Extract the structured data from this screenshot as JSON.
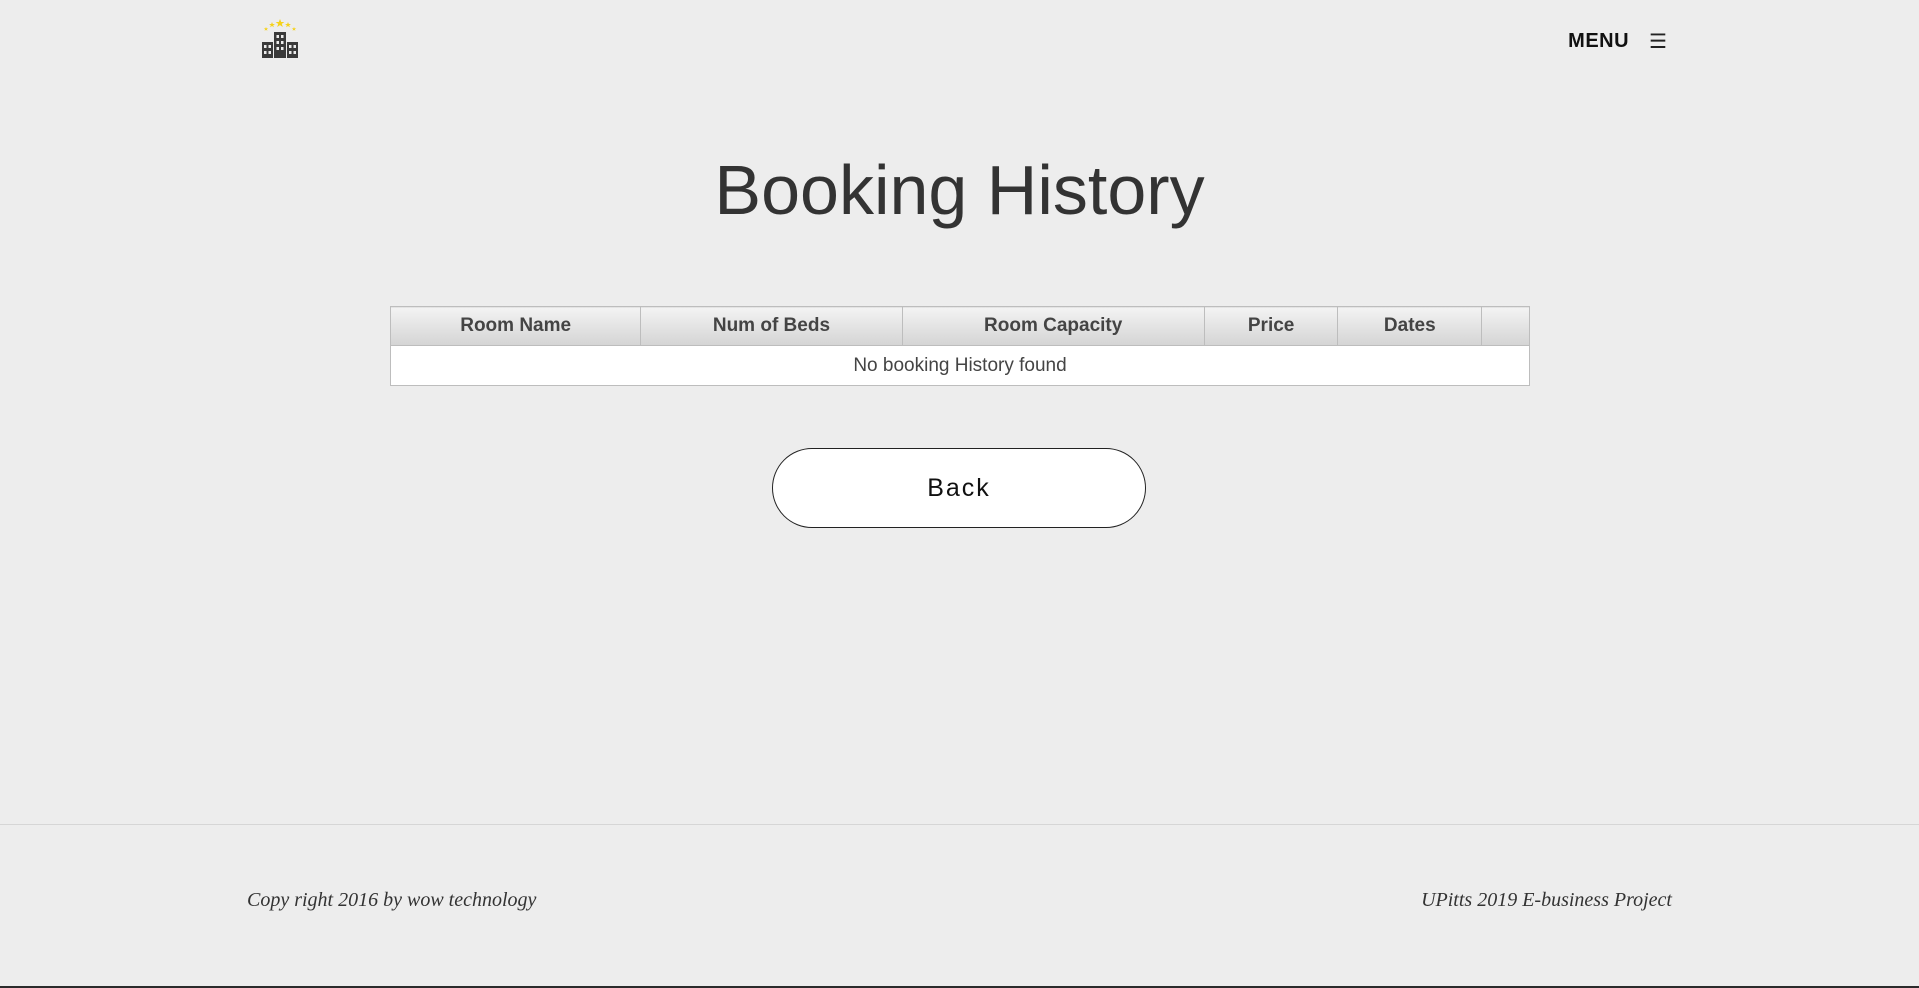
{
  "header": {
    "logo_icon": "hotel-buildings-stars-icon",
    "menu_label": "MENU",
    "menu_icon": "☰"
  },
  "page": {
    "title": "Booking History"
  },
  "table": {
    "columns": [
      "Room Name",
      "Num of Beds",
      "Room Capacity",
      "Price",
      "Dates",
      ""
    ],
    "empty_message": "No booking History found"
  },
  "actions": {
    "back_label": "Back"
  },
  "footer": {
    "left_text": "Copy right 2016 by wow technology",
    "right_text": "UPitts 2019 E-business Project"
  },
  "colors": {
    "background": "#ededed",
    "logo_star": "#f5d21b",
    "logo_building": "#3a3a3a"
  }
}
